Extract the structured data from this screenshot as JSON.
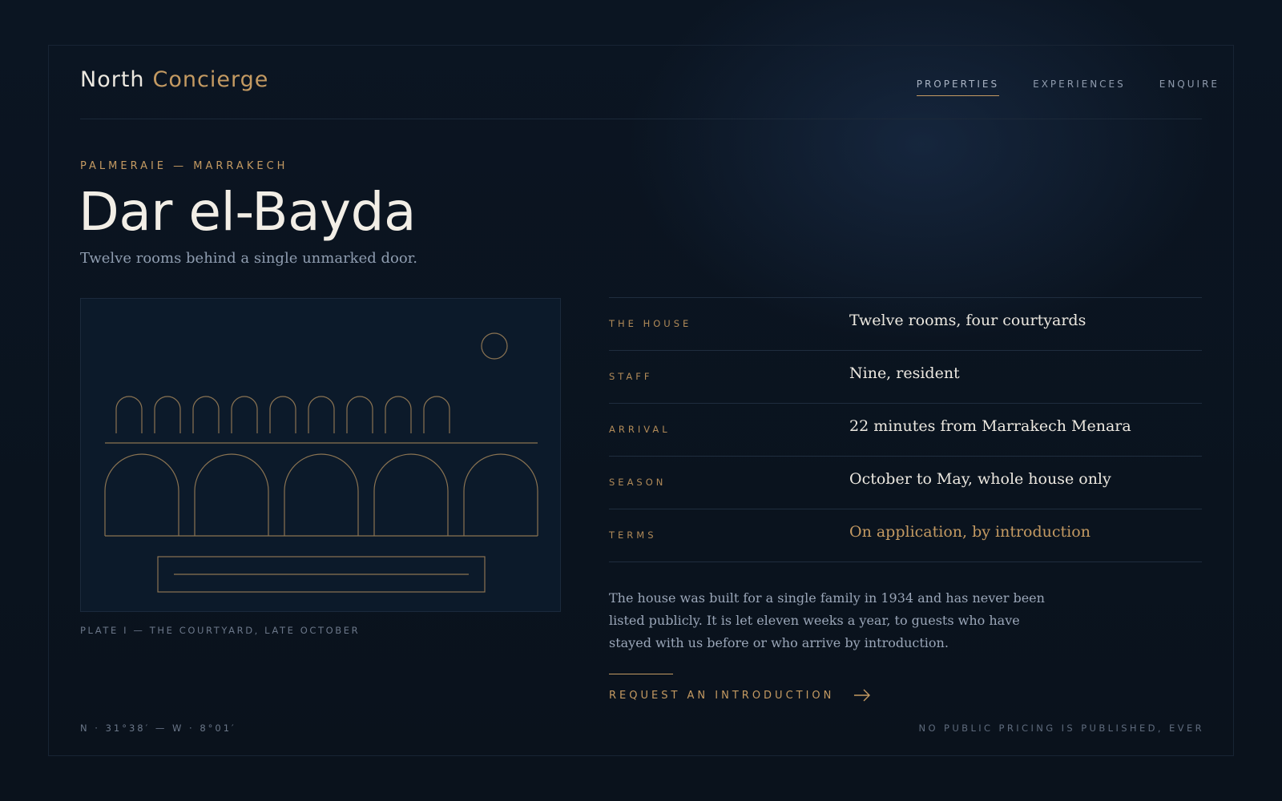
{
  "brand": {
    "name": "North",
    "accent": "Concierge"
  },
  "nav": {
    "items": [
      {
        "label": "PROPERTIES",
        "active": true
      },
      {
        "label": "EXPERIENCES",
        "active": false
      },
      {
        "label": "ENQUIRE",
        "active": false
      }
    ]
  },
  "hero": {
    "eyebrow": "PALMERAIE — MARRAKECH",
    "title": "Dar el-Bayda",
    "subtitle": "Twelve rooms behind a single unmarked door."
  },
  "plate": {
    "caption": "PLATE I — THE COURTYARD, LATE OCTOBER"
  },
  "details": [
    {
      "label": "THE HOUSE",
      "value": "Twelve rooms, four courtyards"
    },
    {
      "label": "STAFF",
      "value": "Nine, resident"
    },
    {
      "label": "ARRIVAL",
      "value": "22 minutes from Marrakech Menara"
    },
    {
      "label": "SEASON",
      "value": "October to May, whole house only"
    },
    {
      "label": "TERMS",
      "value": "On application, by introduction"
    }
  ],
  "description": "The house was built for a single family in 1934 and has never been listed publicly. It is let eleven weeks a year, to guests who have stayed with us before or who arrive by introduction.",
  "cta": {
    "label": "REQUEST AN INTRODUCTION",
    "icon": "arrow-right-icon"
  },
  "footer": {
    "coordinates": "N · 31°38′ — W · 8°01′",
    "note": "NO PUBLIC PRICING IS PUBLISHED, EVER"
  },
  "colors": {
    "background": "#0a121c",
    "accent": "#c49a62",
    "text": "#ece8e0",
    "muted": "#8f9db0"
  }
}
